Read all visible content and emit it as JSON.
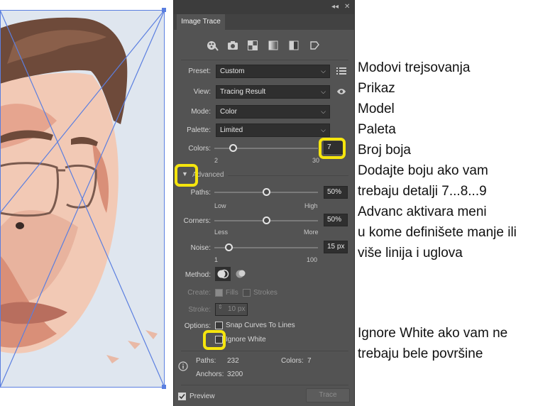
{
  "panel": {
    "tab_title": "Image Trace",
    "collapse_ctl": "◂◂",
    "close_ctl": "✕",
    "menu_icon": "hamburger-icon",
    "presets_icons": [
      "auto-color-icon",
      "high-color-icon",
      "low-color-icon",
      "grayscale-icon",
      "black-white-icon",
      "outline-icon"
    ],
    "preset": {
      "label": "Preset:",
      "value": "Custom"
    },
    "view": {
      "label": "View:",
      "value": "Tracing Result"
    },
    "mode": {
      "label": "Mode:",
      "value": "Color"
    },
    "palette": {
      "label": "Palette:",
      "value": "Limited"
    },
    "colors": {
      "label": "Colors:",
      "value": "7",
      "min": "2",
      "max": "30",
      "level": 7
    },
    "advanced": {
      "label": "Advanced"
    },
    "paths": {
      "label": "Paths:",
      "value": "50%",
      "min": "Low",
      "max": "High",
      "level": 0.5
    },
    "corners": {
      "label": "Corners:",
      "value": "50%",
      "min": "Less",
      "max": "More",
      "level": 0.5
    },
    "noise": {
      "label": "Noise:",
      "value": "15 px",
      "min": "1",
      "max": "100",
      "level": 15
    },
    "method": {
      "label": "Method:"
    },
    "create": {
      "label": "Create:",
      "fills": "Fills",
      "strokes": "Strokes"
    },
    "stroke": {
      "label": "Stroke:",
      "value": "10 px"
    },
    "options": {
      "label": "Options:",
      "snap": "Snap Curves To Lines",
      "ignore_white": "Ignore White"
    },
    "stats": {
      "paths_label": "Paths:",
      "paths_value": "232",
      "colors_label": "Colors:",
      "colors_value": "7",
      "anchors_label": "Anchors:",
      "anchors_value": "3200"
    },
    "preview": "Preview",
    "trace_button": "Trace",
    "highlight_color": "#f5e50e"
  },
  "notes": [
    "Modovi trejsovanja",
    "Prikaz",
    "Model",
    "Paleta",
    "Broj boja",
    "Dodajte boju ako vam",
    "trebaju detalji 7...8...9",
    "Advanc aktivara meni",
    "u kome definišete manje ili",
    "više linija i uglova",
    "Ignore White ako vam ne",
    "trebaju bele površine"
  ]
}
